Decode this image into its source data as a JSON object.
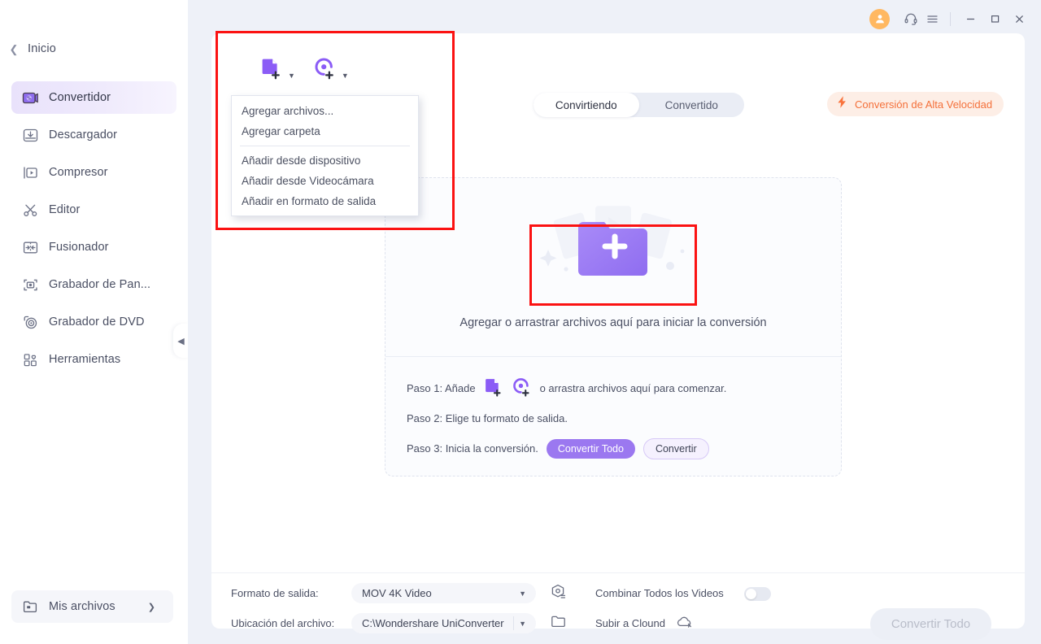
{
  "sidebar": {
    "home": {
      "label": "Inicio",
      "chevron_icon": "chevron-left-icon"
    },
    "items": [
      {
        "label": "Convertidor",
        "icon": "convert-video-icon",
        "active": true
      },
      {
        "label": "Descargador",
        "icon": "download-tray-icon",
        "active": false
      },
      {
        "label": "Compresor",
        "icon": "compress-film-icon",
        "active": false
      },
      {
        "label": "Editor",
        "icon": "scissors-icon",
        "active": false
      },
      {
        "label": "Fusionador",
        "icon": "merge-arrows-icon",
        "active": false
      },
      {
        "label": "Grabador de Pan...",
        "icon": "screen-record-icon",
        "active": false
      },
      {
        "label": "Grabador de DVD",
        "icon": "dvd-disc-icon",
        "active": false
      },
      {
        "label": "Herramientas",
        "icon": "toolbox-grid-icon",
        "active": false
      }
    ],
    "my_files": {
      "label": "Mis archivos",
      "icon": "folder-files-icon",
      "arrow_icon": "chevron-right-icon"
    },
    "collapse": {
      "icon": "collapse-left-icon"
    }
  },
  "titlebar": {
    "account_icon": "user-avatar-icon",
    "support_icon": "headset-icon",
    "menu_icon": "hamburger-menu-icon",
    "minimize_icon": "minimize-icon",
    "maximize_icon": "maximize-icon",
    "close_icon": "close-icon"
  },
  "toolbar": {
    "add_files_icon": "add-file-icon",
    "add_files_caret_icon": "chevron-down-icon",
    "add_dvd_icon": "add-disc-icon",
    "add_dvd_caret_icon": "chevron-down-icon",
    "tabs": [
      {
        "label": "Convirtiendo",
        "selected": true
      },
      {
        "label": "Convertido",
        "selected": false
      }
    ],
    "high_speed": {
      "label": "Conversión de Alta Velocidad",
      "icon": "lightning-bolt-icon",
      "color": "#f4703a"
    }
  },
  "dropdown_menu": {
    "groups": [
      {
        "items": [
          "Agregar archivos...",
          "Agregar carpeta"
        ]
      },
      {
        "items": [
          "Añadir desde dispositivo",
          "Añadir desde Videocámara",
          "Añadir en formato de salida"
        ]
      }
    ]
  },
  "dropzone": {
    "folder_icon": "add-folder-plus-icon",
    "caption": "Agregar o arrastrar archivos aquí para iniciar la conversión",
    "steps": [
      {
        "prefix": "Paso 1: Añade",
        "suffix": "o arrastra archivos aquí para comenzar.",
        "icons": [
          "add-file-icon",
          "add-disc-icon"
        ]
      },
      {
        "prefix": "Paso 2: Elige tu formato de salida.",
        "suffix": "",
        "icons": []
      },
      {
        "prefix": "Paso 3: Inicia la conversión.",
        "suffix": "",
        "icons": [],
        "buttons": [
          {
            "label": "Convertir Todo",
            "style": "primary"
          },
          {
            "label": "Convertir",
            "style": "ghost"
          }
        ]
      }
    ]
  },
  "bottombar": {
    "output_format_label": "Formato de salida:",
    "output_format_value": "MOV 4K Video",
    "output_format_caret_icon": "chevron-down-icon",
    "settings_icon": "format-settings-icon",
    "file_location_label": "Ubicación del archivo:",
    "file_location_value": "C:\\Wondershare UniConverter",
    "file_location_caret_icon": "chevron-down-icon",
    "folder_icon": "open-folder-icon",
    "merge_label": "Combinar Todos los Videos",
    "merge_toggle_on": false,
    "cloud_label": "Subir a Clound",
    "cloud_icon": "cloud-upload-icon",
    "convert_all_label": "Convertir Todo"
  },
  "annotations": {
    "highlight_color": "#fb1212",
    "boxes": [
      {
        "name": "add-files-menu-highlight"
      },
      {
        "name": "dropzone-folder-highlight"
      }
    ]
  }
}
